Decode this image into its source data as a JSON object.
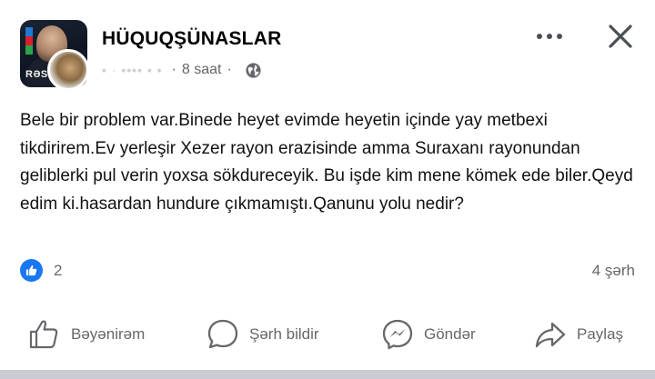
{
  "header": {
    "group_name": "HÜQUQŞÜNASLAR",
    "author": "• · •••• • •",
    "separator": "·",
    "time": "8 saat",
    "avatar_text": "RƏS"
  },
  "post": {
    "text": "Bele bir problem var.Binede heyet evimde heyetin içinde yay metbexi tikdirirem.Ev yerleşir Xezer rayon erazisinde amma Suraxanı rayonundan geliblerki pul verin yoxsa sökdureceyik. Bu işde kim mene kömek ede biler.Qeyd edim ki.hasardan hundure çıkmamıştı.Qanunu yolu nedir?"
  },
  "stats": {
    "like_count": "2",
    "comment_count": "4 şərh"
  },
  "actions": {
    "like_label": "Bəyənirəm",
    "comment_label": "Şərh bildir",
    "send_label": "Göndər",
    "share_label": "Paylaş"
  },
  "colors": {
    "accent": "#1877f2",
    "secondary_text": "#65676b",
    "primary_text": "#050505"
  },
  "icons": [
    "globe-icon",
    "more-icon",
    "close-icon",
    "like-badge-icon",
    "like-icon",
    "comment-icon",
    "messenger-icon",
    "share-icon"
  ]
}
